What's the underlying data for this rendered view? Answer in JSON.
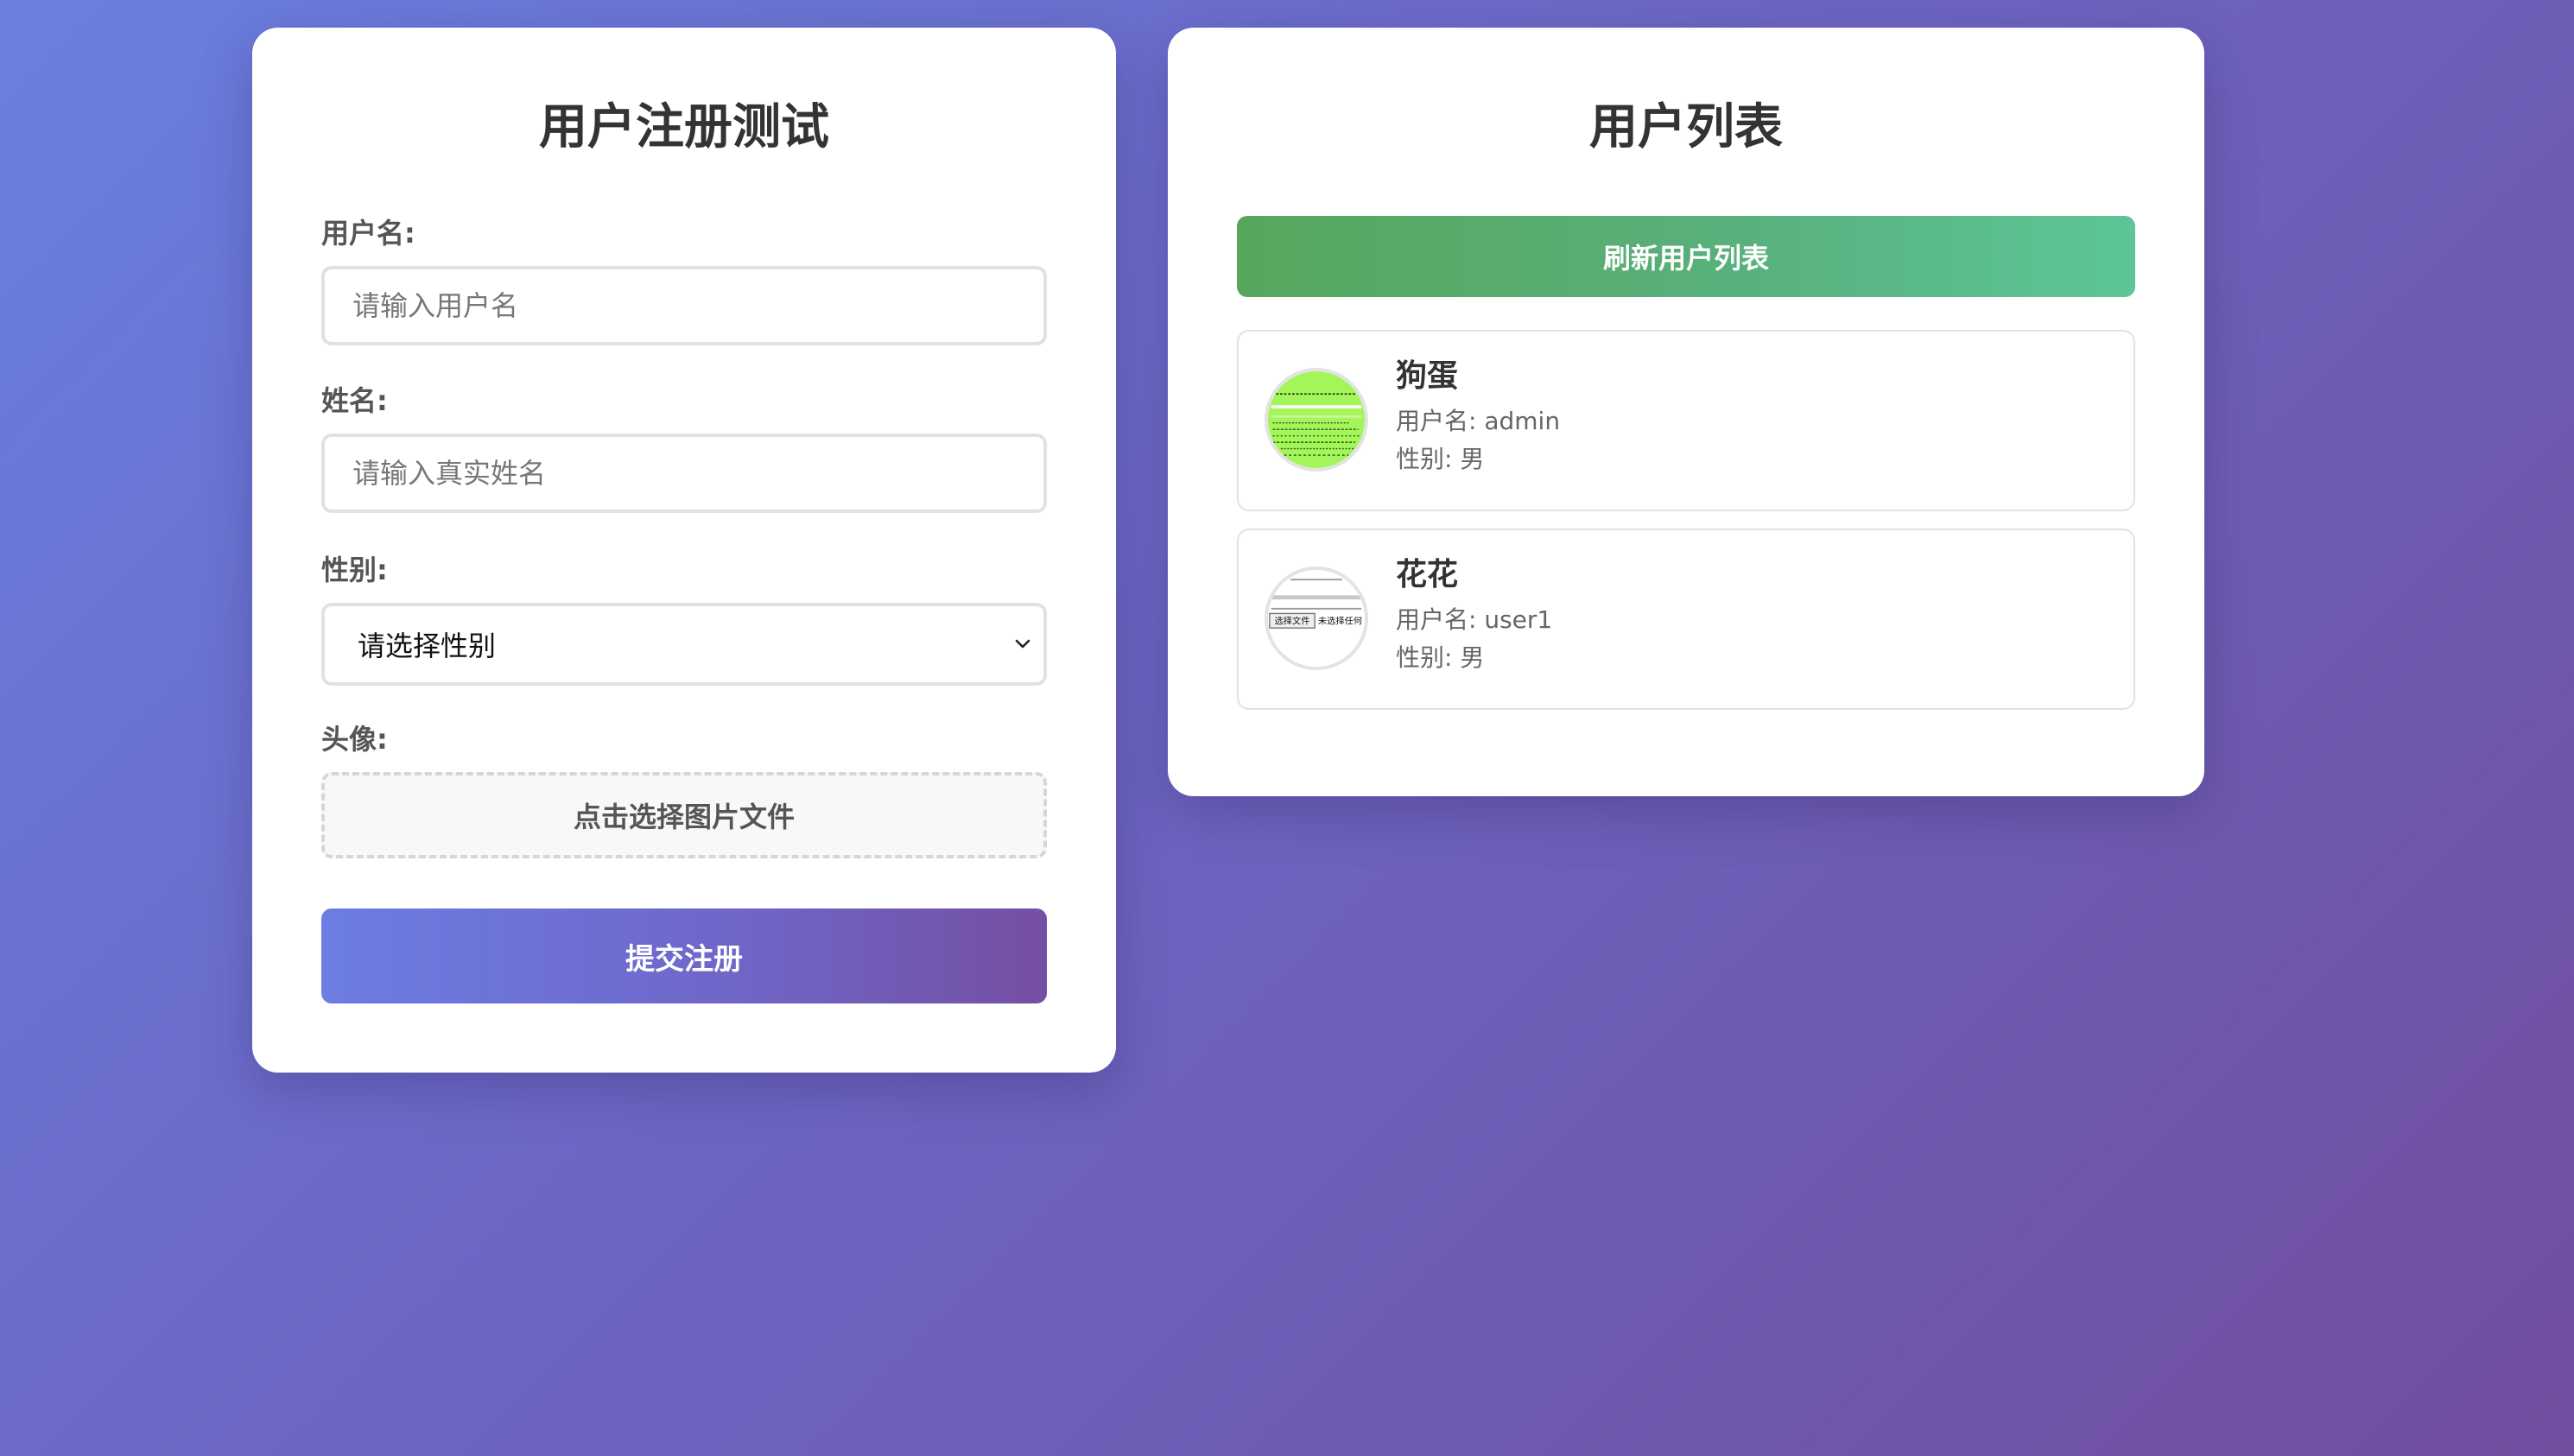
{
  "register": {
    "title": "用户注册测试",
    "username_label": "用户名:",
    "username_placeholder": "请输入用户名",
    "name_label": "姓名:",
    "name_placeholder": "请输入真实姓名",
    "gender_label": "性别:",
    "gender_selected": "请选择性别",
    "avatar_label": "头像:",
    "avatar_upload_text": "点击选择图片文件",
    "submit_label": "提交注册"
  },
  "users": {
    "title": "用户列表",
    "refresh_label": "刷新用户列表",
    "items": [
      {
        "name": "狗蛋",
        "username": "用户名: admin",
        "gender": "性别: 男",
        "avatar_icon": "green-code-thumbnail-icon"
      },
      {
        "name": "花花",
        "username": "用户名: user1",
        "gender": "性别: 男",
        "avatar_icon": "file-input-thumbnail-icon",
        "avatar_text_1": "选择文件",
        "avatar_text_2": "未选择任何"
      }
    ]
  },
  "colors": {
    "background_start": "#6a7fe0",
    "background_end": "#714ea0",
    "submit_start": "#6c7de3",
    "submit_end": "#754fa3",
    "refresh_start": "#56a75c",
    "refresh_end": "#5dc596",
    "avatar_green": "#a3f55a"
  }
}
